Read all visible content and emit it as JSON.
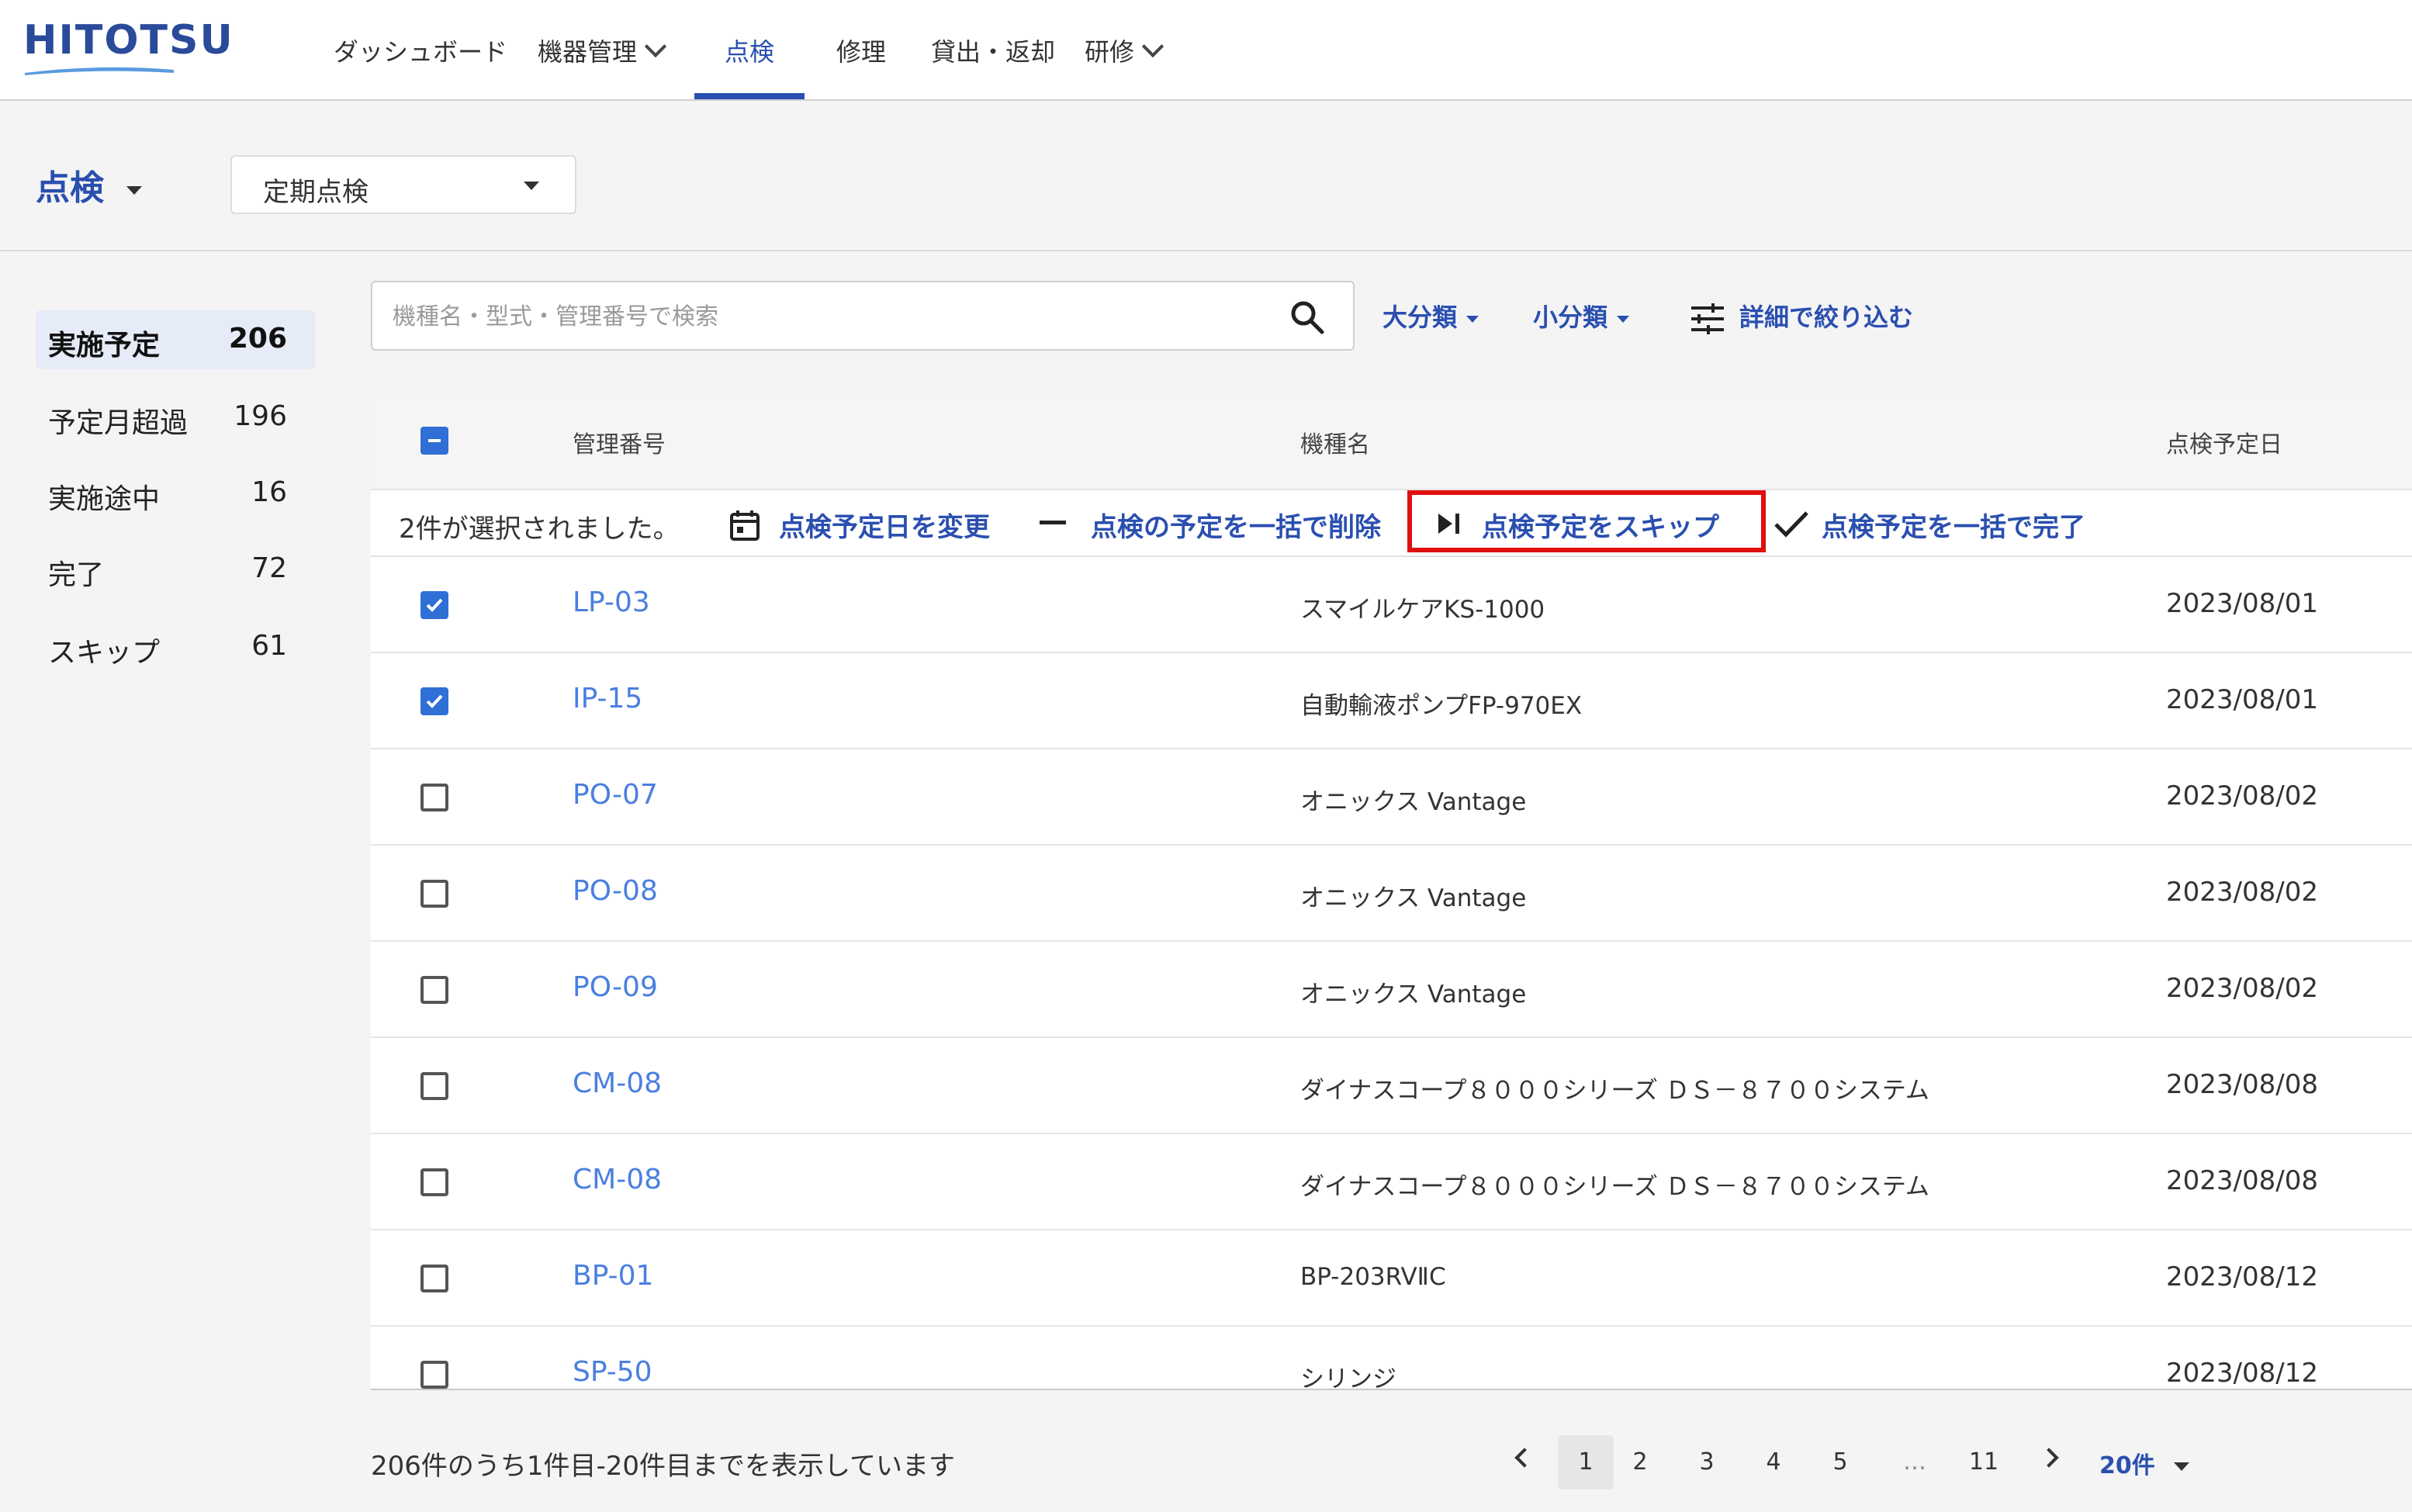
{
  "app": {
    "logo_text": "HITOTSU",
    "brand_color": "#2a4a9a",
    "accent_color": "#2a4fb0",
    "link_color": "#4a7fe0"
  },
  "nav": {
    "items": [
      {
        "label": "ダッシュボード"
      },
      {
        "label": "機器管理",
        "has_dropdown": true
      },
      {
        "label": "点検",
        "active": true
      },
      {
        "label": "修理"
      },
      {
        "label": "貸出・返却"
      },
      {
        "label": "研修",
        "has_dropdown": true
      }
    ]
  },
  "page": {
    "title": "点検",
    "type_select_value": "定期点検"
  },
  "sidebar": {
    "items": [
      {
        "label": "実施予定",
        "count": "206",
        "active": true
      },
      {
        "label": "予定月超過",
        "count": "196"
      },
      {
        "label": "実施途中",
        "count": "16"
      },
      {
        "label": "完了",
        "count": "72"
      },
      {
        "label": "スキップ",
        "count": "61"
      }
    ]
  },
  "search": {
    "placeholder": "機種名・型式・管理番号で検索",
    "value": ""
  },
  "filters": {
    "major_category": "大分類",
    "minor_category": "小分類",
    "detail_filter": "詳細で絞り込む"
  },
  "table": {
    "headers": {
      "mgmt_number": "管理番号",
      "model_name": "機種名",
      "scheduled_date": "点検予定日"
    },
    "selection_text": "2件が選択されました。",
    "actions": {
      "change_date": "点検予定日を変更",
      "bulk_delete": "点検の予定を一括で削除",
      "skip": "点検予定をスキップ",
      "bulk_complete": "点検予定を一括で完了"
    },
    "rows": [
      {
        "checked": true,
        "mgmt": "LP-03",
        "model": "スマイルケアKS-1000",
        "date": "2023/08/01"
      },
      {
        "checked": true,
        "mgmt": "IP-15",
        "model": "自動輸液ポンプFP-970EX",
        "date": "2023/08/01"
      },
      {
        "checked": false,
        "mgmt": "PO-07",
        "model": "オニックス Vantage",
        "date": "2023/08/02"
      },
      {
        "checked": false,
        "mgmt": "PO-08",
        "model": "オニックス Vantage",
        "date": "2023/08/02"
      },
      {
        "checked": false,
        "mgmt": "PO-09",
        "model": "オニックス Vantage",
        "date": "2023/08/02"
      },
      {
        "checked": false,
        "mgmt": "CM-08",
        "model": "ダイナスコープ８０００シリーズ ＤＳ－８７００システム",
        "date": "2023/08/08"
      },
      {
        "checked": false,
        "mgmt": "CM-08",
        "model": "ダイナスコープ８０００シリーズ ＤＳ－８７００システム",
        "date": "2023/08/08"
      },
      {
        "checked": false,
        "mgmt": "BP-01",
        "model": "BP-203RVⅡC",
        "date": "2023/08/12"
      },
      {
        "checked": false,
        "mgmt": "SP-50",
        "model": "シリンジ",
        "date": "2023/08/12"
      }
    ]
  },
  "footer": {
    "count_text": "206件のうち1件目-20件目までを表示しています",
    "pages": [
      "1",
      "2",
      "3",
      "4",
      "5",
      "…",
      "11"
    ],
    "current_page": "1",
    "per_page": "20件"
  }
}
